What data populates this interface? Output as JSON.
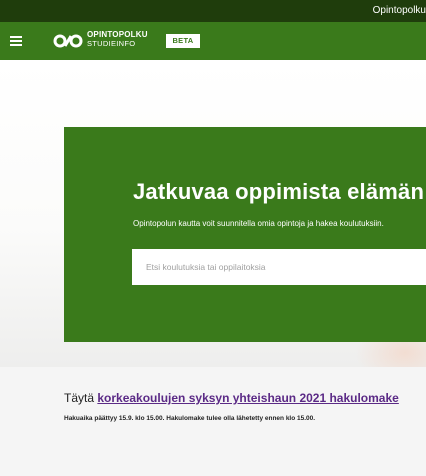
{
  "topbar": {
    "link_label": "Opintopolku"
  },
  "header": {
    "menu_icon": "hamburger-menu-icon",
    "logo_icon": "opintopolku-logo-icon",
    "logo_line1": "OPINTOPOLKU",
    "logo_line2": "STUDIEINFO",
    "beta_label": "BETA",
    "color": "#3a7a1b"
  },
  "hero": {
    "title": "Jatkuvaa oppimista elämän",
    "subtitle": "Opintopolun kautta voit suunnitella omia opintoja ja hakea koulutuksiin.",
    "search_placeholder": "Etsi koulutuksia tai oppilaitoksia"
  },
  "notice": {
    "title_prefix": "Täytä ",
    "title_link": "korkeakoulujen syksyn yhteishaun 2021 hakulomake",
    "description": "Hakuaika päättyy 15.9. klo 15.00. Hakulomake tulee olla lähetetty ennen klo 15.00."
  }
}
